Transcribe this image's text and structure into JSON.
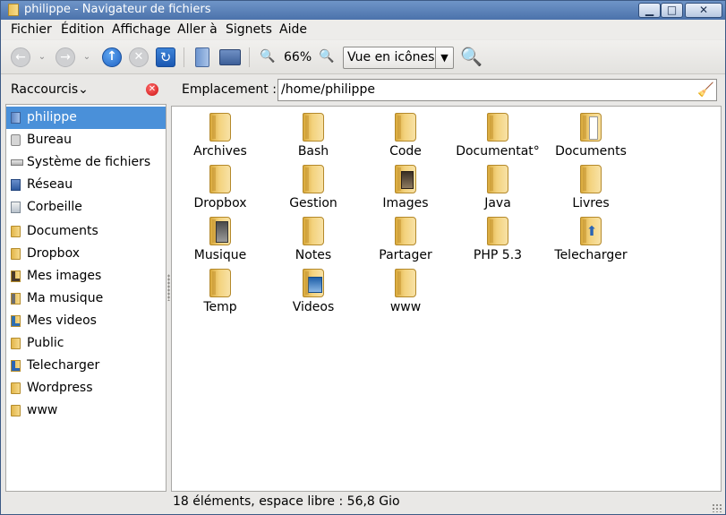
{
  "window": {
    "title": "philippe - Navigateur de fichiers",
    "min_glyph": "▁",
    "max_glyph": "□",
    "close_glyph": "✕"
  },
  "menubar": {
    "items": [
      {
        "label": "Fichier"
      },
      {
        "label": "Édition"
      },
      {
        "label": "Affichage"
      },
      {
        "label": "Aller à"
      },
      {
        "label": "Signets"
      },
      {
        "label": "Aide"
      }
    ]
  },
  "toolbar": {
    "back_glyph": "←",
    "forward_glyph": "→",
    "caret_glyph": "⌄",
    "up_glyph": "↑",
    "stop_glyph": "✕",
    "reload_glyph": "↻",
    "zoom_out_glyph": "🔍",
    "zoom_level": "66%",
    "zoom_in_glyph": "🔍",
    "view_mode": "Vue en icônes",
    "view_arrow": "▼",
    "search_glyph": "🔍"
  },
  "sidebar": {
    "title": "Raccourcis⌄",
    "close_glyph": "✕",
    "items": [
      {
        "label": "philippe",
        "icon": "home-folder-icon"
      },
      {
        "label": "Bureau",
        "icon": "desktop-icon"
      },
      {
        "label": "Système de fichiers",
        "icon": "filesystem-icon"
      },
      {
        "label": "Réseau",
        "icon": "network-icon"
      },
      {
        "label": "Corbeille",
        "icon": "trash-icon"
      },
      {
        "label": "Documents",
        "icon": "documents-folder-icon"
      },
      {
        "label": "Dropbox",
        "icon": "folder-icon"
      },
      {
        "label": "Mes images",
        "icon": "pictures-folder-icon"
      },
      {
        "label": "Ma musique",
        "icon": "music-folder-icon"
      },
      {
        "label": "Mes videos",
        "icon": "videos-folder-icon"
      },
      {
        "label": "Public",
        "icon": "folder-icon"
      },
      {
        "label": "Telecharger",
        "icon": "downloads-folder-icon"
      },
      {
        "label": "Wordpress",
        "icon": "folder-icon"
      },
      {
        "label": "www",
        "icon": "folder-icon"
      }
    ]
  },
  "location": {
    "label": "Emplacement :",
    "path": "/home/philippe",
    "clear_glyph": "🧹"
  },
  "files": [
    {
      "name": "Archives",
      "kind": "folder"
    },
    {
      "name": "Bash",
      "kind": "folder"
    },
    {
      "name": "Code",
      "kind": "folder"
    },
    {
      "name": "Documentat°",
      "kind": "folder"
    },
    {
      "name": "Documents",
      "kind": "documents"
    },
    {
      "name": "Dropbox",
      "kind": "folder"
    },
    {
      "name": "Gestion",
      "kind": "folder"
    },
    {
      "name": "Images",
      "kind": "pictures"
    },
    {
      "name": "Java",
      "kind": "folder"
    },
    {
      "name": "Livres",
      "kind": "folder"
    },
    {
      "name": "Musique",
      "kind": "music"
    },
    {
      "name": "Notes",
      "kind": "folder"
    },
    {
      "name": "Partager",
      "kind": "folder"
    },
    {
      "name": "PHP 5.3",
      "kind": "folder"
    },
    {
      "name": "Telecharger",
      "kind": "downloads"
    },
    {
      "name": "Temp",
      "kind": "folder"
    },
    {
      "name": "Videos",
      "kind": "videos"
    },
    {
      "name": "www",
      "kind": "folder"
    }
  ],
  "status": {
    "text": "18 éléments, espace libre : 56,8 Gio"
  },
  "colors": {
    "selection": "#4a90d9",
    "titlebar": "#4b72ab",
    "folder": "#f3d27d"
  }
}
